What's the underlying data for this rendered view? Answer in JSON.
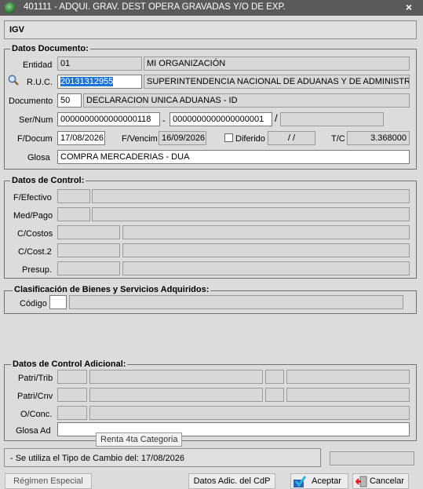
{
  "window": {
    "title": "401111 - ADQUI. GRAV. DEST OPERA GRAVADAS Y/O DE EXP.",
    "close": "×"
  },
  "tax_label": "IGV",
  "doc": {
    "section_title": "Datos Documento:",
    "entidad_label": "Entidad",
    "entidad_code": "01",
    "entidad_name": "MI ORGANIZACIÓN",
    "ruc_label": "R.U.C.",
    "ruc_value": "20131312955",
    "ruc_name": "SUPERINTENDENCIA NACIONAL DE ADUANAS Y DE ADMINISTRACIO",
    "documento_label": "Documento",
    "documento_code": "50",
    "documento_name": "DECLARACION UNICA ADUANAS - ID",
    "sernum_label": "Ser/Num",
    "serie": "0000000000000000118",
    "sep_dash": "-",
    "numero": "0000000000000000001",
    "sep_slash": "/",
    "fdocum_label": "F/Docum",
    "fdocum_value": "17/08/2026",
    "fvencim_label": "F/Vencim",
    "fvencim_value": "16/09/2026",
    "diferido_label": "Diferido",
    "diferido_value": "/  /",
    "tc_label": "T/C",
    "tc_value": "3.368000",
    "glosa_label": "Glosa",
    "glosa_value": "COMPRA MERCADERIAS - DUA"
  },
  "control": {
    "section_title": "Datos de Control:",
    "fefectivo_label": "F/Efectivo",
    "medpago_label": "Med/Pago",
    "ccostos_label": "C/Costos",
    "ccost2_label": "C/Cost.2",
    "presup_label": "Presup."
  },
  "clasif": {
    "section_title": "Clasificación de Bienes y Servicios Adquiridos:",
    "codigo_label": "Código"
  },
  "adicional": {
    "section_title": "Datos de Control Adicional:",
    "patritrib_label": "Patri/Trib",
    "patricnv_label": "Patri/Cnv",
    "oconc_label": "O/Conc.",
    "glosaad_label": "Glosa Ad"
  },
  "tooltip": "Renta 4ta Categoria",
  "status": "- Se utiliza el Tipo de Cambio del: 17/08/2026",
  "buttons": {
    "regimen": "Régimen Especial",
    "datos_adic": "Datos Adic. del CdP",
    "aceptar": "Aceptar",
    "cancelar": "Cancelar"
  }
}
